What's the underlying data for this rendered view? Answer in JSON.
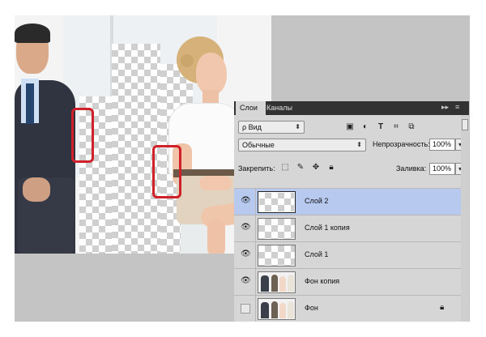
{
  "layers_panel": {
    "tabs": [
      {
        "label": "Слои",
        "active": true
      },
      {
        "label": "Каналы",
        "active": false
      }
    ],
    "expand_icon": "double-chevron-right-icon",
    "menu_icon": "panel-menu-icon",
    "filter": {
      "kind_label": "ρ Вид",
      "icons": [
        "image-filter-icon",
        "adjustment-filter-icon",
        "type-filter-icon",
        "shape-filter-icon",
        "smart-object-filter-icon"
      ]
    },
    "blend_mode": "Обычные",
    "opacity_label": "Непрозрачность:",
    "opacity_value": "100%",
    "lock_label": "Закрепить:",
    "lock_icons": [
      "lock-transparent-icon",
      "lock-brush-icon",
      "lock-move-icon",
      "lock-all-icon"
    ],
    "fill_label": "Заливка:",
    "fill_value": "100%",
    "layers": [
      {
        "name": "Слой 2",
        "visible": true,
        "selected": true,
        "thumb": "transparent"
      },
      {
        "name": "Слой 1 копия",
        "visible": true,
        "selected": false,
        "thumb": "transparent"
      },
      {
        "name": "Слой 1",
        "visible": true,
        "selected": false,
        "thumb": "transparent"
      },
      {
        "name": "Фон копия",
        "visible": true,
        "selected": false,
        "thumb": "photo"
      },
      {
        "name": "Фон",
        "visible": false,
        "selected": false,
        "thumb": "photo",
        "locked": true
      }
    ]
  },
  "colors": {
    "highlight_marker": "#d0202a",
    "selected_layer": "#b7c9ef",
    "panel_bg": "#d6d6d6",
    "tab_bar": "#323232"
  }
}
